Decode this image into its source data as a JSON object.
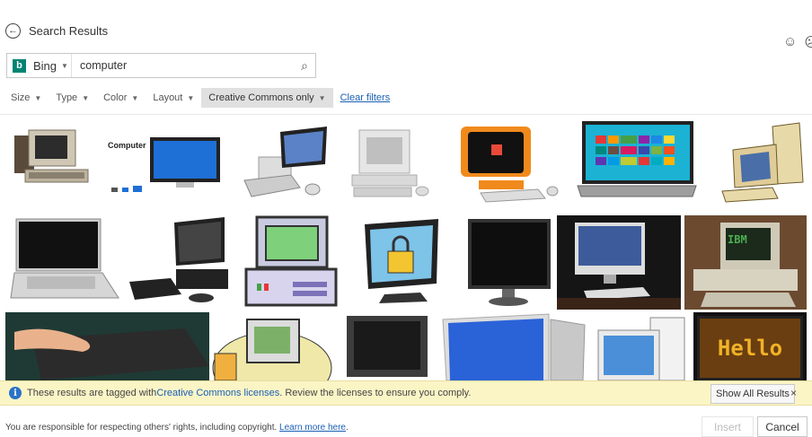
{
  "header": {
    "title": "Search Results",
    "back_icon": "back-arrow-icon"
  },
  "feedback_icons": [
    "☺",
    "☹"
  ],
  "search": {
    "provider": "Bing",
    "provider_logo": "b",
    "query": "computer"
  },
  "filters": [
    {
      "label": "Size",
      "active": false
    },
    {
      "label": "Type",
      "active": false
    },
    {
      "label": "Color",
      "active": false
    },
    {
      "label": "Layout",
      "active": false
    },
    {
      "label": "Creative Commons only",
      "active": true
    }
  ],
  "clear_filters": "Clear filters",
  "results": [
    "retro computer with keyboard",
    "Computer desktop monitor diagram",
    "computer clipart monitor keyboard mouse",
    "beige computer with keyboard",
    "orange retro iMac",
    "laptop with colorful tiles",
    "beige desktop computer clipart",
    "silver laptop",
    "desktop computer with tower",
    "cartoon computer terminal",
    "monitor with padlock",
    "flat panel monitor",
    "iMac on desk",
    "IBM personal computer",
    "hand on keyboard",
    "cartoon computer with pencils",
    "CRT monitor",
    "blue screen monitor",
    "white desktop computer",
    "Hello screen"
  ],
  "hello_text": "Hello",
  "screen_brand": "IBM",
  "computer_card_label": "Computer",
  "notice": {
    "text_before": "These results are tagged with ",
    "link": "Creative Commons licenses",
    "text_after": ". Review the licenses to ensure you comply.",
    "show_all": "Show All Results",
    "close": "×"
  },
  "footer": {
    "text": "You are responsible for respecting others' rights, including copyright. ",
    "link": "Learn more here",
    "link_suffix": "."
  },
  "buttons": {
    "insert": "Insert",
    "cancel": "Cancel"
  }
}
